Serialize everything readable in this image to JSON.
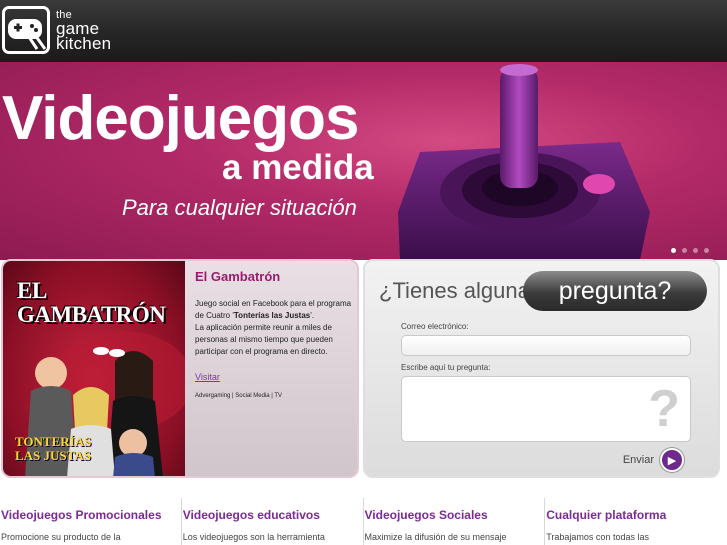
{
  "header": {
    "logo": {
      "line1": "the",
      "line2": "game",
      "line3": "kitchen"
    }
  },
  "hero": {
    "title": "Videojuegos",
    "subtitle1": "a medida",
    "subtitle2": "Para cualquier situación",
    "slides": 4,
    "active_slide": 1
  },
  "feature": {
    "image_title": "EL GAMBATRÓN",
    "image_subtitle_line1": "TONTERÍAS",
    "image_subtitle_line2": "LAS JUSTAS",
    "title": "El Gambatrón",
    "body_part1": "Juego social en Facebook para el programa de Cuatro '",
    "body_bold": "Tonterías las Justas",
    "body_part2": "'.",
    "body_line2": "La aplicación permite reunir a miles de personas al mismo tiempo que pueden participar con el programa en directo.",
    "link": "Visitar",
    "tags": "Advergaming | Social Media | TV"
  },
  "question": {
    "heading": "¿Tienes alguna",
    "pill": "pregunta?",
    "email_label": "Correo electrónico:",
    "email_value": "",
    "question_label": "Escribe aquí tu pregunta:",
    "question_value": "",
    "watermark": "?",
    "send_label": "Enviar",
    "send_icon": "play-arrow-icon"
  },
  "columns": [
    {
      "title": "Videojuegos Promocionales",
      "text": "Promocione su producto de la"
    },
    {
      "title": "Videojuegos educativos",
      "text": "Los videojuegos son la herramienta"
    },
    {
      "title": "Videojuegos Sociales",
      "text": "Maximize la difusión de su mensaje"
    },
    {
      "title": "Cualquier plataforma",
      "text": "Trabajamos con todas las"
    }
  ],
  "colors": {
    "header_bg": "#262626",
    "hero_magenta": "#b32a68",
    "accent_purple": "#7c2a96",
    "feature_title": "#9b1b6d"
  }
}
